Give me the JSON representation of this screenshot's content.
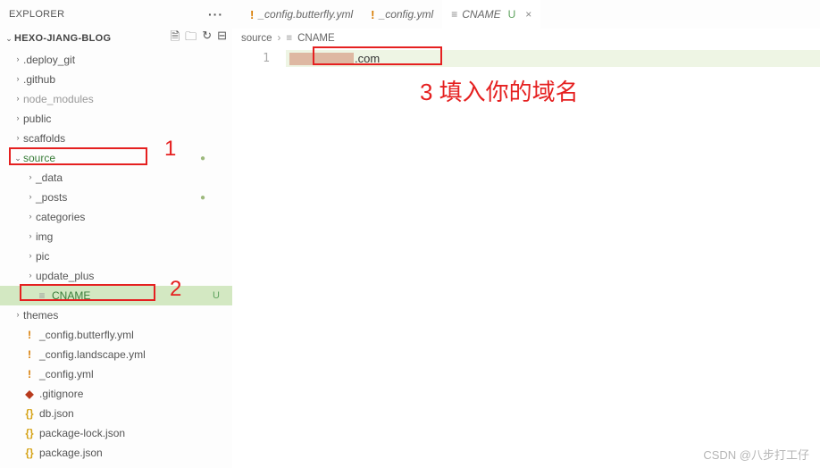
{
  "explorer_title": "EXPLORER",
  "project_name": "HEXO-JIANG-BLOG",
  "proj_actions": [
    "new-file",
    "new-folder",
    "refresh",
    "collapse"
  ],
  "tabs": [
    {
      "icon": "yaml",
      "icon_char": "!",
      "label": "_config.butterfly.yml",
      "active": false
    },
    {
      "icon": "yaml",
      "icon_char": "!",
      "label": "_config.yml",
      "active": false
    },
    {
      "icon": "text",
      "icon_char": "≡",
      "label": "CNAME",
      "u_mark": "U",
      "active": true,
      "closeable": true
    }
  ],
  "breadcrumb": [
    {
      "label": "source"
    },
    {
      "icon": "≡",
      "label": "CNAME"
    }
  ],
  "tree": [
    {
      "d": 1,
      "caret": "right",
      "label": ".deploy_git"
    },
    {
      "d": 1,
      "caret": "right",
      "label": ".github"
    },
    {
      "d": 1,
      "caret": "right",
      "label": "node_modules",
      "dim": true
    },
    {
      "d": 1,
      "caret": "right",
      "label": "public"
    },
    {
      "d": 1,
      "caret": "right",
      "label": "scaffolds"
    },
    {
      "d": 1,
      "caret": "down",
      "label": "source",
      "green": true,
      "dot": true
    },
    {
      "d": 2,
      "caret": "right",
      "label": "_data"
    },
    {
      "d": 2,
      "caret": "right",
      "label": "_posts",
      "dot": true
    },
    {
      "d": 2,
      "caret": "right",
      "label": "categories"
    },
    {
      "d": 2,
      "caret": "right",
      "label": "img"
    },
    {
      "d": 2,
      "caret": "right",
      "label": "pic"
    },
    {
      "d": 2,
      "caret": "right",
      "label": "update_plus"
    },
    {
      "d": 2,
      "icon": "text",
      "icon_char": "≡",
      "label": "CNAME",
      "green": true,
      "selected": true,
      "u": "U"
    },
    {
      "d": 1,
      "caret": "right",
      "label": "themes"
    },
    {
      "d": 1,
      "icon": "yaml",
      "icon_char": "!",
      "label": "_config.butterfly.yml"
    },
    {
      "d": 1,
      "icon": "yaml",
      "icon_char": "!",
      "label": "_config.landscape.yml"
    },
    {
      "d": 1,
      "icon": "yaml",
      "icon_char": "!",
      "label": "_config.yml"
    },
    {
      "d": 1,
      "icon": "git",
      "icon_char": "◆",
      "label": ".gitignore"
    },
    {
      "d": 1,
      "icon": "json",
      "icon_char": "{}",
      "label": "db.json"
    },
    {
      "d": 1,
      "icon": "json",
      "icon_char": "{}",
      "label": "package-lock.json"
    },
    {
      "d": 1,
      "icon": "json",
      "icon_char": "{}",
      "label": "package.json"
    }
  ],
  "editor": {
    "line_number": "1",
    "line_suffix": ".com"
  },
  "annotations": {
    "a1": "1",
    "a2": "2",
    "a3": "3 填入你的域名"
  },
  "watermark": "CSDN @八步打工仔"
}
